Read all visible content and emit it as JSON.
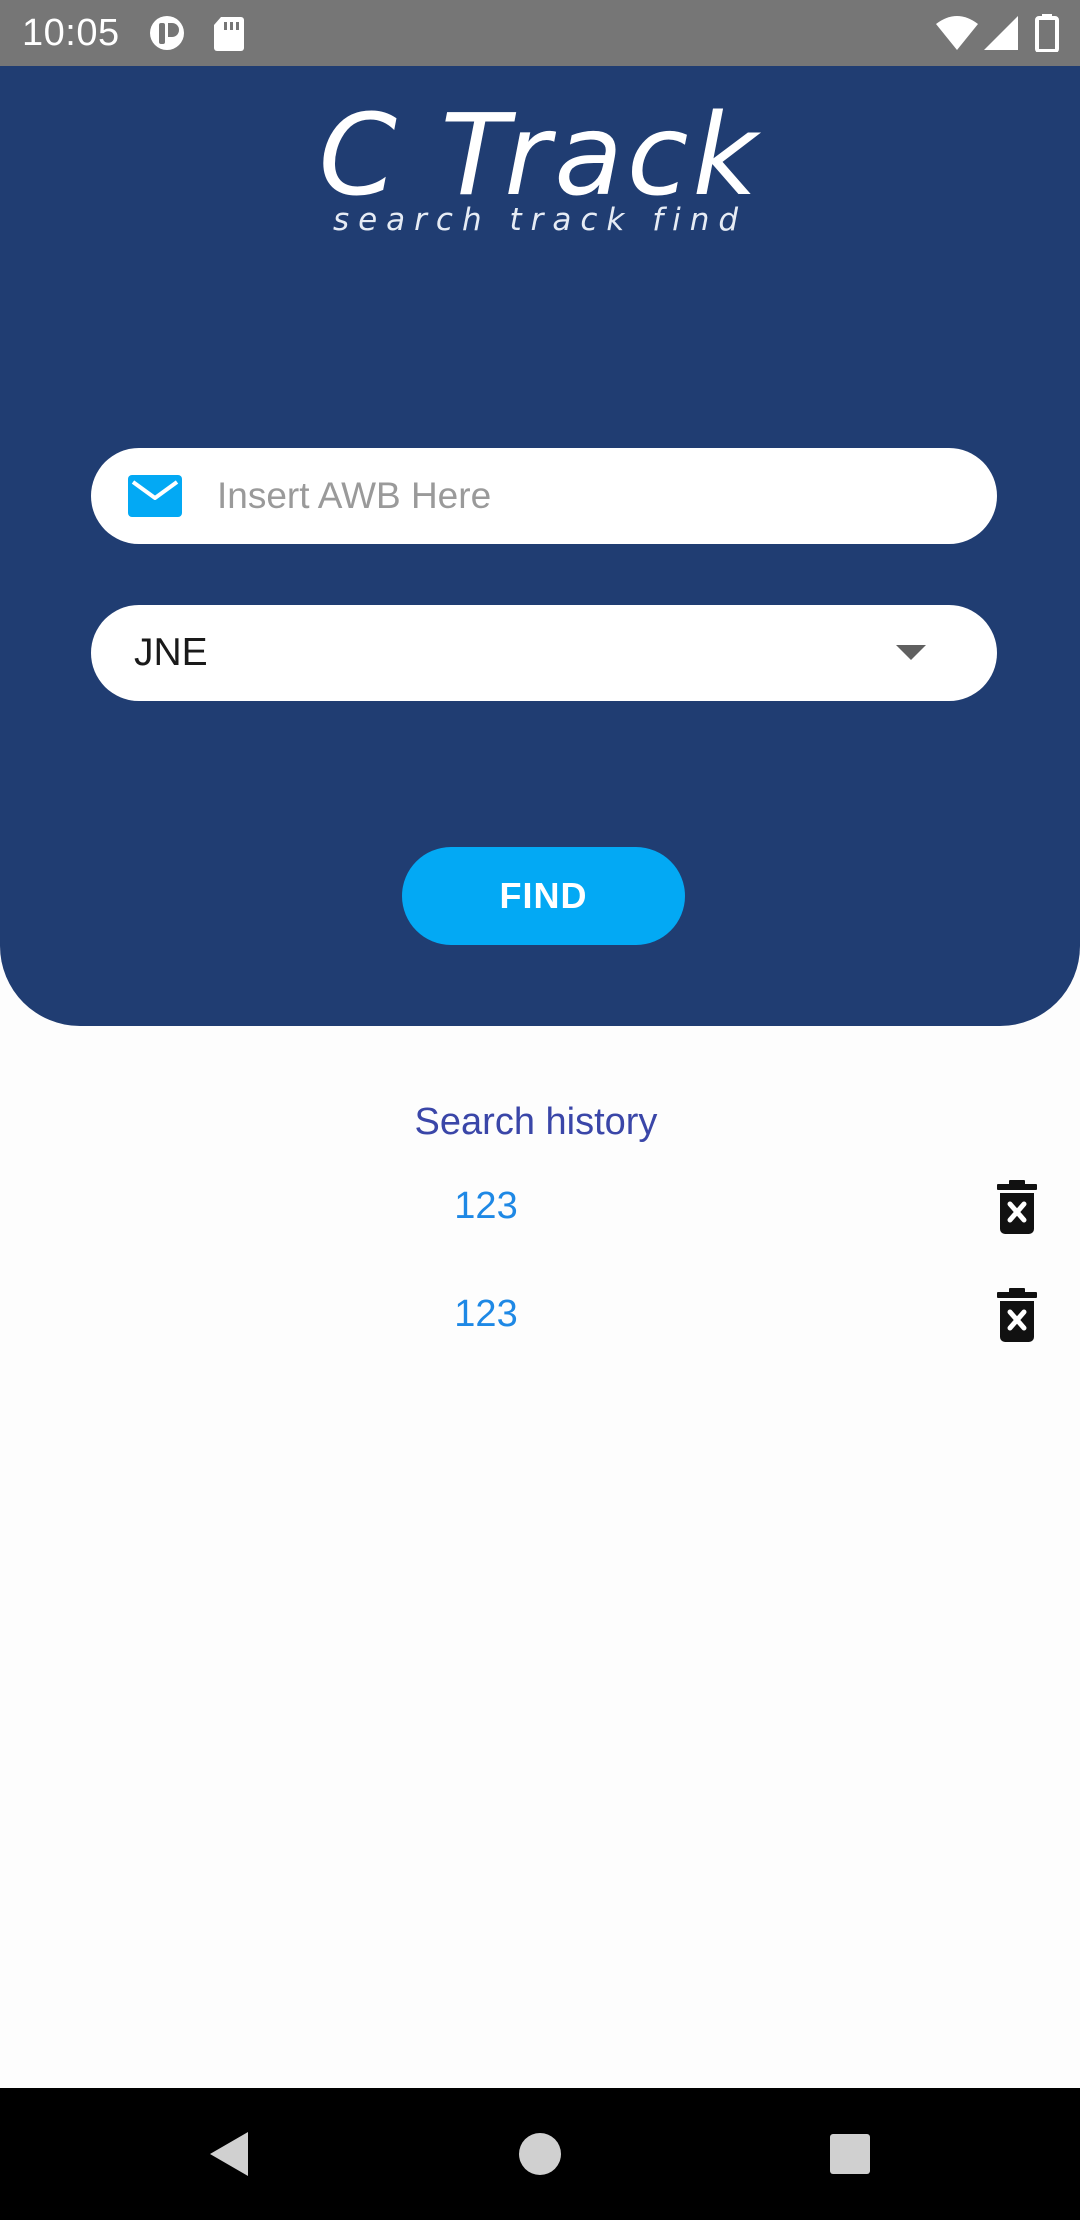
{
  "status_bar": {
    "time": "10:05",
    "icons": [
      "notification-app-icon",
      "sd-card-icon",
      "wifi-icon",
      "signal-icon",
      "battery-icon"
    ]
  },
  "header": {
    "logo": {
      "title": "C Track",
      "tagline": "search track find"
    },
    "awb_input": {
      "icon": "mail-icon",
      "placeholder": "Insert AWB Here",
      "value": ""
    },
    "courier_select": {
      "value": "JNE",
      "icon": "dropdown-arrow-icon"
    },
    "find_button": {
      "label": "FIND"
    }
  },
  "history": {
    "title": "Search history",
    "items": [
      {
        "value": "123",
        "icon": "delete-icon"
      },
      {
        "value": "123",
        "icon": "delete-icon"
      }
    ]
  },
  "nav_bar": {
    "buttons": [
      "back-icon",
      "home-icon",
      "recents-icon"
    ]
  },
  "colors": {
    "header_bg": "#203d72",
    "accent": "#03a9f4",
    "history_title": "#3a46a8",
    "history_value": "#1e88e5",
    "status_bar_bg": "#767676",
    "nav_bar_bg": "#000000"
  }
}
